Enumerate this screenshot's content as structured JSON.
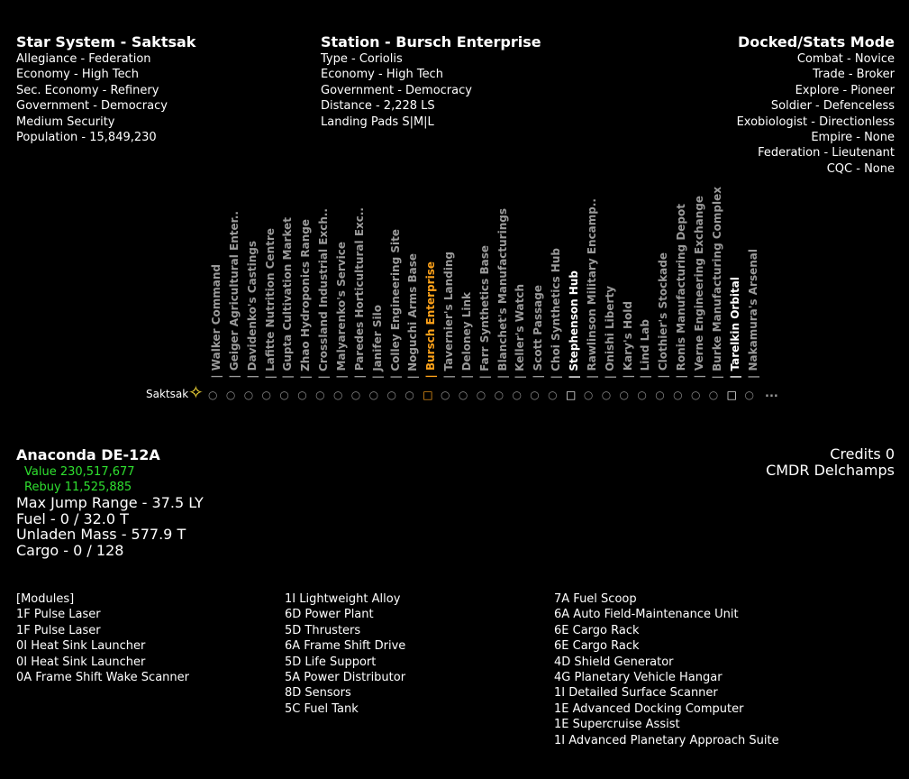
{
  "system": {
    "title": "Star System - Saktsak",
    "lines": [
      "Allegiance - Federation",
      "Economy - High Tech",
      "Sec. Economy - Refinery",
      "Government - Democracy",
      "Medium Security",
      "Population - 15,849,230"
    ]
  },
  "station": {
    "title": "Station - Bursch Enterprise",
    "lines": [
      "Type - Coriolis",
      "Economy - High Tech",
      "Government - Democracy",
      "Distance - 2,228 LS",
      "Landing Pads S|M|L"
    ]
  },
  "mode": {
    "title": "Docked/Stats Mode",
    "lines": [
      "Combat - Novice",
      "Trade - Broker",
      "Explore - Pioneer",
      "Soldier - Defenceless",
      "Exobiologist - Directionless",
      "Empire - None",
      "Federation - Lieutenant",
      "CQC - None"
    ]
  },
  "bodies": {
    "star_name": "Saktsak",
    "star_icon": "star-icon",
    "more": "...",
    "items": [
      {
        "label": "| Walker Command",
        "glyph": "○",
        "state": "normal"
      },
      {
        "label": "| Geiger Agricultural Enter..",
        "glyph": "○",
        "state": "normal"
      },
      {
        "label": "| Davidenko's Castings",
        "glyph": "○",
        "state": "normal"
      },
      {
        "label": "| Lafitte Nutrition Centre",
        "glyph": "○",
        "state": "normal"
      },
      {
        "label": "| Gupta Cultivation Market",
        "glyph": "○",
        "state": "normal"
      },
      {
        "label": "| Zhao Hydroponics Range",
        "glyph": "○",
        "state": "normal"
      },
      {
        "label": "| Crossland Industrial Exch..",
        "glyph": "○",
        "state": "normal"
      },
      {
        "label": "| Malyarenko's Service",
        "glyph": "○",
        "state": "normal"
      },
      {
        "label": "| Paredes Horticultural Exc..",
        "glyph": "○",
        "state": "normal"
      },
      {
        "label": "| Janifer Silo",
        "glyph": "○",
        "state": "normal"
      },
      {
        "label": "| Colley Engineering Site",
        "glyph": "○",
        "state": "normal"
      },
      {
        "label": "| Noguchi Arms Base",
        "glyph": "○",
        "state": "normal"
      },
      {
        "label": "| Bursch Enterprise",
        "glyph": "□",
        "state": "orange"
      },
      {
        "label": "| Tavernier's Landing",
        "glyph": "○",
        "state": "normal"
      },
      {
        "label": "| Deloney Link",
        "glyph": "○",
        "state": "normal"
      },
      {
        "label": "| Farr Synthetics Base",
        "glyph": "○",
        "state": "normal"
      },
      {
        "label": "| Blanchet's Manufacturings",
        "glyph": "○",
        "state": "normal"
      },
      {
        "label": "| Keller's Watch",
        "glyph": "○",
        "state": "normal"
      },
      {
        "label": "| Scott Passage",
        "glyph": "○",
        "state": "normal"
      },
      {
        "label": "| Choi Synthetics Hub",
        "glyph": "○",
        "state": "normal"
      },
      {
        "label": "| Stephenson Hub",
        "glyph": "□",
        "state": "white"
      },
      {
        "label": "| Rawlinson Military Encamp..",
        "glyph": "○",
        "state": "normal"
      },
      {
        "label": "| Onishi Liberty",
        "glyph": "○",
        "state": "normal"
      },
      {
        "label": "| Kary's Hold",
        "glyph": "○",
        "state": "normal"
      },
      {
        "label": "| Lind Lab",
        "glyph": "○",
        "state": "normal"
      },
      {
        "label": "| Clothier's Stockade",
        "glyph": "○",
        "state": "normal"
      },
      {
        "label": "| Ronis Manufacturing Depot",
        "glyph": "○",
        "state": "normal"
      },
      {
        "label": "| Verne Engineering Exchange",
        "glyph": "○",
        "state": "normal"
      },
      {
        "label": "| Burke Manufacturing Complex",
        "glyph": "○",
        "state": "normal"
      },
      {
        "label": "| Tarelkin Orbital",
        "glyph": "□",
        "state": "white"
      },
      {
        "label": "| Nakamura's Arsenal",
        "glyph": "○",
        "state": "normal"
      }
    ]
  },
  "ship": {
    "name": "Anaconda  DE-12A",
    "value": "Value 230,517,677",
    "rebuy": "Rebuy 11,525,885",
    "jump": "Max Jump Range - 37.5 LY",
    "fuel": "Fuel - 0 / 32.0 T",
    "mass": "Unladen Mass - 577.9 T",
    "cargo": "Cargo - 0 / 128"
  },
  "commander": {
    "credits": "Credits 0",
    "name": "CMDR Delchamps"
  },
  "modules": {
    "col1": [
      "[Modules]",
      "1F Pulse Laser",
      "1F Pulse Laser",
      "0I Heat Sink Launcher",
      "0I Heat Sink Launcher",
      "0A Frame Shift Wake Scanner"
    ],
    "col2": [
      "1I Lightweight Alloy",
      "6D Power Plant",
      "5D Thrusters",
      "6A Frame Shift Drive",
      "5D Life Support",
      "5A Power Distributor",
      "8D Sensors",
      "5C Fuel Tank"
    ],
    "col3": [
      "7A Fuel Scoop",
      "6A Auto Field-Maintenance Unit",
      "6E Cargo Rack",
      "6E Cargo Rack",
      "4D Shield Generator",
      "4G Planetary Vehicle Hangar",
      "1I Detailed Surface Scanner",
      "1E Advanced Docking Computer",
      "1E Supercruise Assist",
      "1I Advanced Planetary Approach Suite"
    ]
  },
  "colors": {
    "background": "#000000",
    "text": "#ffffff",
    "muted": "#9a9a9a",
    "highlight": "#ffa31a",
    "green": "#2fe02f",
    "star": "#ffe23a"
  }
}
